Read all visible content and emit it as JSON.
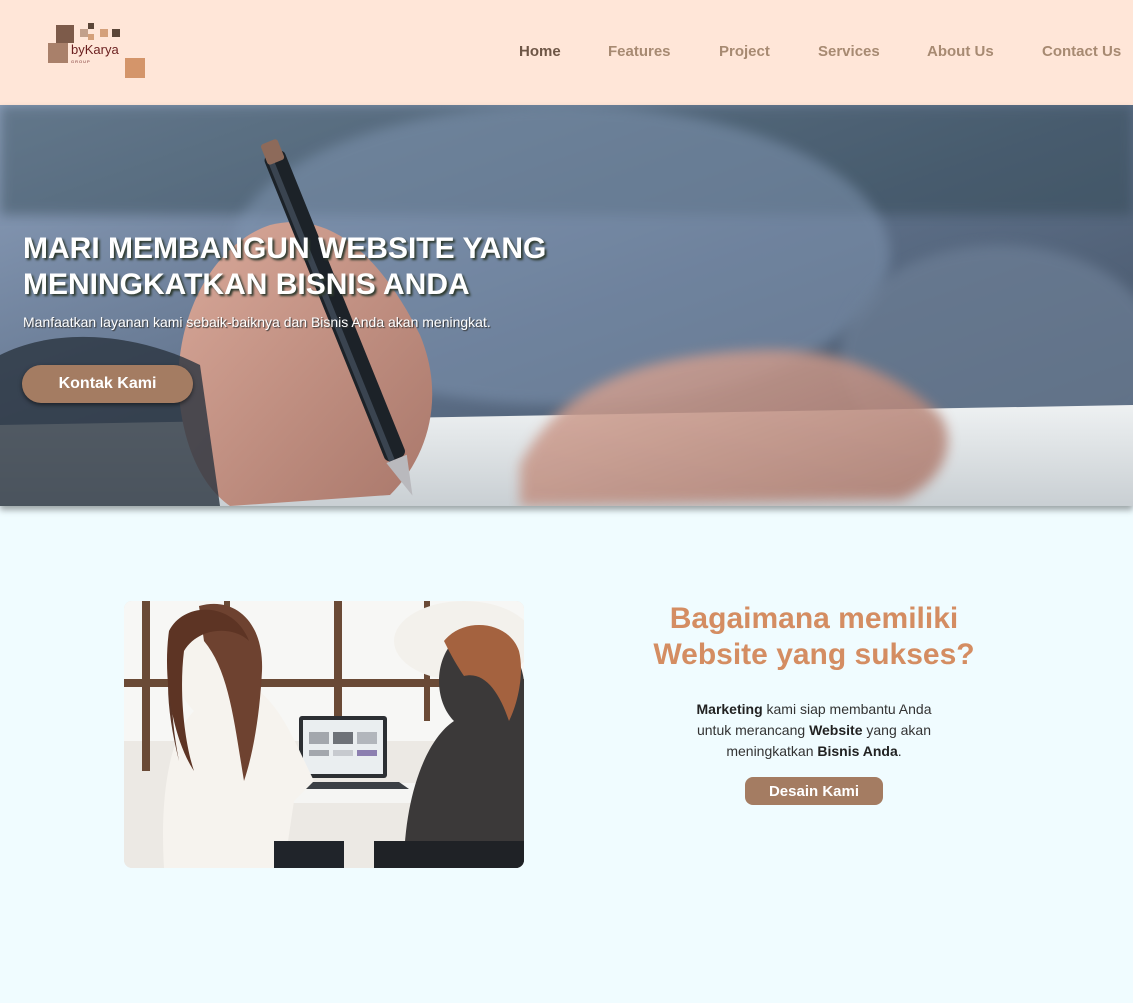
{
  "header": {
    "logo_text": "byKarya",
    "logo_sub": "GROUP",
    "nav": [
      {
        "label": "Home",
        "active": true
      },
      {
        "label": "Features"
      },
      {
        "label": "Project"
      },
      {
        "label": "Services"
      },
      {
        "label": "About Us"
      },
      {
        "label": "Contact Us"
      }
    ]
  },
  "hero": {
    "title": "MARI MEMBANGUN WEBSITE YANG MENINGKATKAN BISNIS ANDA",
    "subtitle": "Manfaatkan layanan kami sebaik-baiknya dan Bisnis Anda akan meningkat.",
    "cta_label": "Kontak Kami"
  },
  "about": {
    "heading": "Bagaimana memiliki Website yang sukses?",
    "desc_parts": [
      "Marketing",
      " kami siap membantu Anda untuk merancang ",
      "Website",
      " yang akan meningkatkan ",
      "Bisnis Anda",
      "."
    ],
    "button_label": "Desain Kami"
  },
  "colors": {
    "header_bg": "#ffe6d8",
    "page_bg": "#f0fcff",
    "accent_brown": "#a47c62",
    "heading_orange": "#d48d62"
  }
}
